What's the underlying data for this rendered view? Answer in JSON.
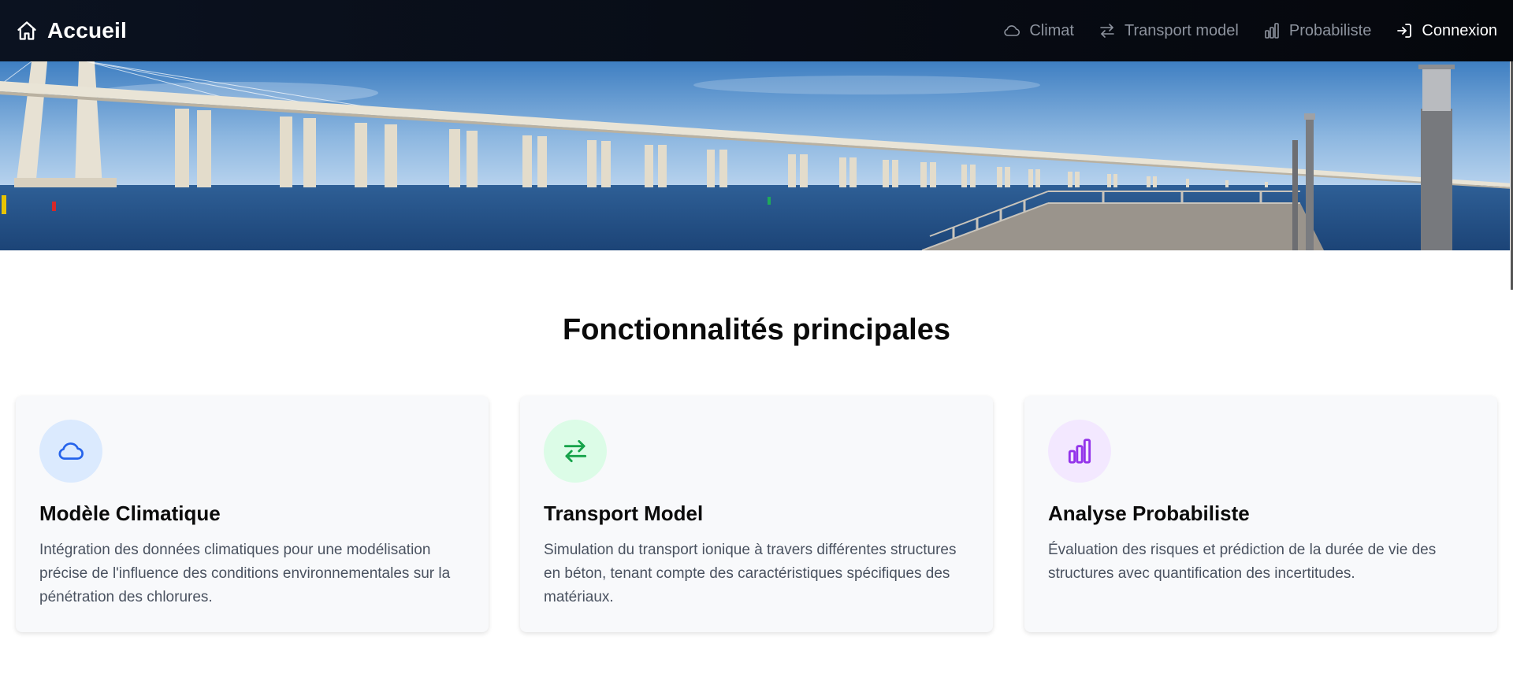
{
  "nav": {
    "brand_label": "Accueil",
    "links": [
      {
        "label": "Climat",
        "icon": "cloud-icon"
      },
      {
        "label": "Transport model",
        "icon": "arrows-exchange-icon"
      },
      {
        "label": "Probabiliste",
        "icon": "bar-chart-icon"
      }
    ],
    "login_label": "Connexion"
  },
  "hero": {
    "image": "bridge-over-water-banner"
  },
  "features": {
    "title": "Fonctionnalités principales",
    "cards": [
      {
        "icon": "cloud-icon",
        "icon_color": "#2563eb",
        "icon_bg": "#dbeafe",
        "title": "Modèle Climatique",
        "text": "Intégration des données climatiques pour une modélisation précise de l'influence des conditions environnementales sur la pénétration des chlorures."
      },
      {
        "icon": "arrows-exchange-icon",
        "icon_color": "#16a34a",
        "icon_bg": "#dcfce7",
        "title": "Transport Model",
        "text": "Simulation du transport ionique à travers différentes structures en béton, tenant compte des caractéristiques spécifiques des matériaux."
      },
      {
        "icon": "bar-chart-icon",
        "icon_color": "#9333ea",
        "icon_bg": "#f3e8ff",
        "title": "Analyse Probabiliste",
        "text": "Évaluation des risques et prédiction de la durée de vie des structures avec quantification des incertitudes."
      }
    ]
  }
}
